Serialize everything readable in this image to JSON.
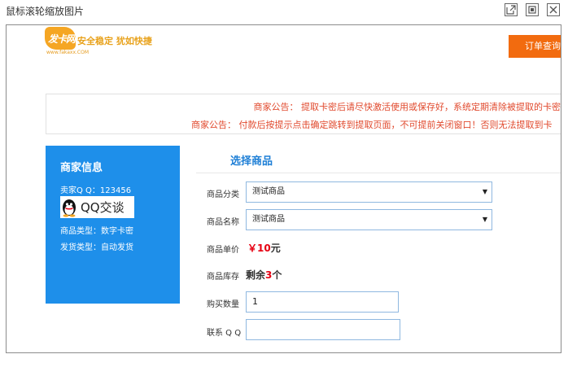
{
  "viewer": {
    "title": "鼠标滚轮缩放图片",
    "buttons": [
      "open-external-icon",
      "maximize-icon",
      "close-icon"
    ]
  },
  "header": {
    "logo_text": "发卡网",
    "logo_url": "www.fakaxx.COM",
    "slogan": "安全稳定  犹如快捷",
    "order_button": "订单查询"
  },
  "notices": [
    "商家公告：  提取卡密后请尽快激活使用或保存好，系统定期清除被提取的卡密",
    "商家公告：  付款后按提示点击确定跳转到提取页面，不可提前关闭窗口！否则无法提取到卡"
  ],
  "seller": {
    "title": "商家信息",
    "qq_label": "卖家Q Q：",
    "qq_number": "123456",
    "qq_badge": "QQ交谈",
    "product_type": "商品类型：数字卡密",
    "delivery_type": "发货类型：自动发货"
  },
  "product": {
    "section_title": "选择商品",
    "category_label": "商品分类",
    "category_value": "测试商品",
    "name_label": "商品名称",
    "name_value": "测试商品",
    "price_label": "商品单价",
    "price_symbol": "￥",
    "price_value": "10",
    "price_unit": "元",
    "stock_label": "商品库存",
    "stock_prefix": "剩余",
    "stock_count": "3",
    "stock_unit": "个",
    "quantity_label": "购买数量",
    "quantity_value": "1",
    "contact_label": "联系 Q Q",
    "contact_value": ""
  },
  "colors": {
    "accent_blue": "#1e8fea",
    "order_orange": "#f26b0f",
    "notice_red": "#e14a2e",
    "price_red": "#e60012"
  }
}
